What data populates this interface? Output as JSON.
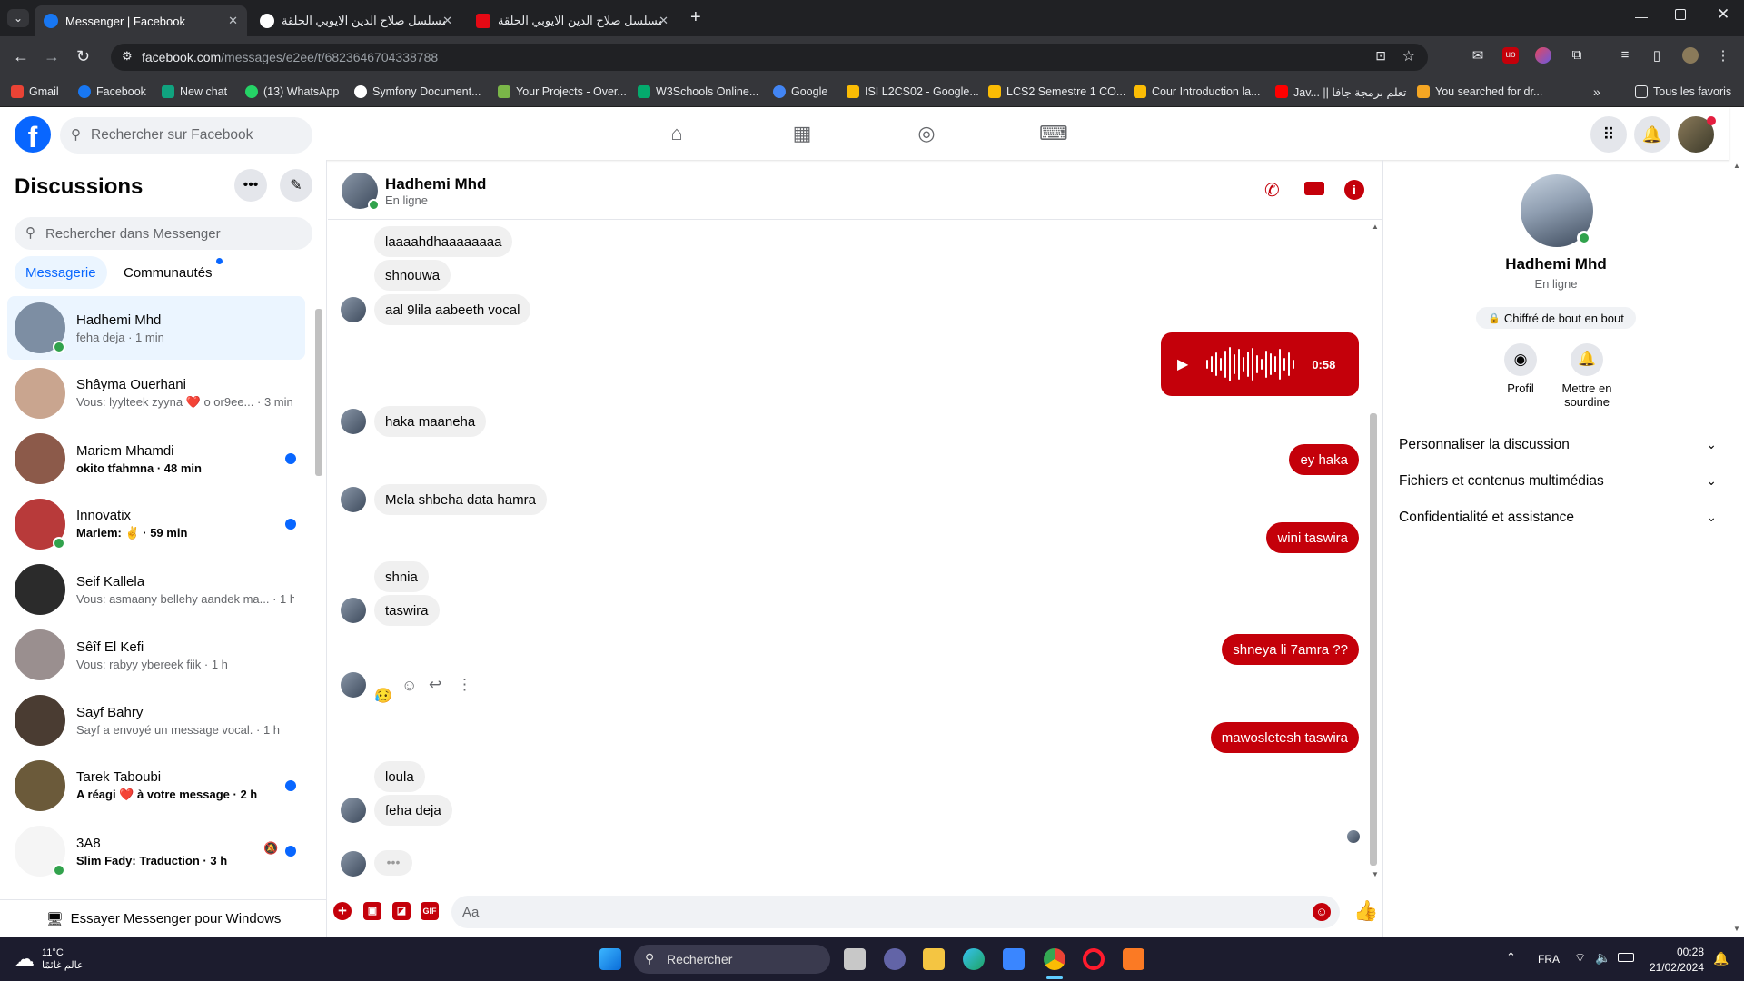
{
  "browser": {
    "tabs": [
      {
        "title": "Messenger | Facebook",
        "active": true
      },
      {
        "title": "مسلسل صلاح الدين الايوبي الحلقة",
        "active": false
      },
      {
        "title": "مسلسل صلاح الدين الايوبي الحلقة",
        "active": false
      }
    ],
    "url_host": "facebook.com",
    "url_path": "/messages/e2ee/t/6823646704338788",
    "bookmarks": [
      {
        "label": "Gmail",
        "color": "#ea4335"
      },
      {
        "label": "Facebook",
        "color": "#1877f2"
      },
      {
        "label": "New chat",
        "color": "#10a37f"
      },
      {
        "label": "(13) WhatsApp",
        "color": "#25d366"
      },
      {
        "label": "Symfony Document...",
        "color": "#ffffff"
      },
      {
        "label": "Your Projects - Over...",
        "color": "#7ab648"
      },
      {
        "label": "W3Schools Online...",
        "color": "#04aa6d"
      },
      {
        "label": "Google",
        "color": "#4285f4"
      },
      {
        "label": "ISI L2CS02 - Google...",
        "color": "#fbbc04"
      },
      {
        "label": "LCS2 Semestre 1 CO...",
        "color": "#fbbc04"
      },
      {
        "label": "Cour Introduction la...",
        "color": "#fbbc04"
      },
      {
        "label": "Jav... || تعلم برمجة جافا",
        "color": "#ff0000"
      },
      {
        "label": "You searched for dr...",
        "color": "#f5a623"
      }
    ],
    "all_bookmarks_label": "Tous les favoris"
  },
  "header": {
    "search_placeholder": "Rechercher sur Facebook"
  },
  "sidebar": {
    "title": "Discussions",
    "search_placeholder": "Rechercher dans Messenger",
    "tabs": [
      "Messagerie",
      "Communautés"
    ],
    "conversations": [
      {
        "name": "Hadhemi Mhd",
        "preview": "feha deja · 1 min",
        "online": true,
        "unread": false,
        "selected": true,
        "color": "#7d8ea3"
      },
      {
        "name": "Shâyma Ouerhani",
        "preview": "Vous: lyylteek zyyna ❤️ o or9ee... · 3 min",
        "online": false,
        "unread": false,
        "selected": false,
        "color": "#c9a58f"
      },
      {
        "name": "Mariem Mhamdi",
        "preview": "okito tfahmna · 48 min",
        "online": false,
        "unread": true,
        "selected": false,
        "color": "#8c5a4a"
      },
      {
        "name": "Innovatix",
        "preview": "Mariem: ✌️ · 59 min",
        "online": true,
        "unread": true,
        "selected": false,
        "color": "#b83a3a"
      },
      {
        "name": "Seif Kallela",
        "preview": "Vous: asmaany bellehy aandek ma... · 1 h",
        "online": false,
        "unread": false,
        "selected": false,
        "color": "#2b2b2b"
      },
      {
        "name": "Sêîf El Kefi",
        "preview": "Vous: rabyy ybereek fiik · 1 h",
        "online": false,
        "unread": false,
        "selected": false,
        "color": "#9a8f8f"
      },
      {
        "name": "Sayf Bahry",
        "preview": "Sayf a envoyé un message vocal. · 1 h",
        "online": false,
        "unread": false,
        "selected": false,
        "color": "#4a3c32"
      },
      {
        "name": "Tarek Taboubi",
        "preview": "A réagi ❤️ à votre message · 2 h",
        "online": false,
        "unread": true,
        "selected": false,
        "color": "#6b5a3a"
      },
      {
        "name": "3A8",
        "preview": "Slim Fady: Traduction · 3 h",
        "online": true,
        "unread": true,
        "selected": false,
        "color": "#f5f5f5"
      }
    ],
    "try_windows": "Essayer Messenger pour Windows"
  },
  "chat": {
    "contact_name": "Hadhemi Mhd",
    "status": "En ligne",
    "messages": [
      {
        "side": "left",
        "text": "laaaahdhaaaaaaaa"
      },
      {
        "side": "left",
        "text": "shnouwa"
      },
      {
        "side": "left",
        "text": "aal 9lila aabeeth vocal"
      },
      {
        "side": "right",
        "text": "0:58",
        "voice": true
      },
      {
        "side": "left",
        "text": "haka maaneha"
      },
      {
        "side": "right",
        "text": "ey haka"
      },
      {
        "side": "left",
        "text": "Mela shbeha data hamra"
      },
      {
        "side": "right",
        "text": "wini taswira"
      },
      {
        "side": "left",
        "text": "shnia"
      },
      {
        "side": "left",
        "text": "taswira"
      },
      {
        "side": "right",
        "text": "shneya li 7amra ??"
      },
      {
        "side": "left",
        "text": "😥"
      },
      {
        "side": "right",
        "text": "mawosletesh taswira"
      },
      {
        "side": "left",
        "text": "loula"
      },
      {
        "side": "left",
        "text": "feha deja"
      }
    ],
    "input_placeholder": "Aa",
    "accent": "#c4000a"
  },
  "details": {
    "name": "Hadhemi Mhd",
    "status": "En ligne",
    "encrypted": "Chiffré de bout en bout",
    "actions": [
      {
        "label": "Profil",
        "icon": "profile-icon"
      },
      {
        "label": "Mettre en sourdine",
        "icon": "bell-icon"
      }
    ],
    "sections": [
      "Personnaliser la discussion",
      "Fichiers et contenus multimédias",
      "Confidentialité et assistance"
    ]
  },
  "taskbar": {
    "temp": "11°C",
    "weather_caption": "عالم غائمًا",
    "search_label": "Rechercher",
    "lang": "FRA",
    "time": "00:28",
    "date": "21/02/2024"
  }
}
